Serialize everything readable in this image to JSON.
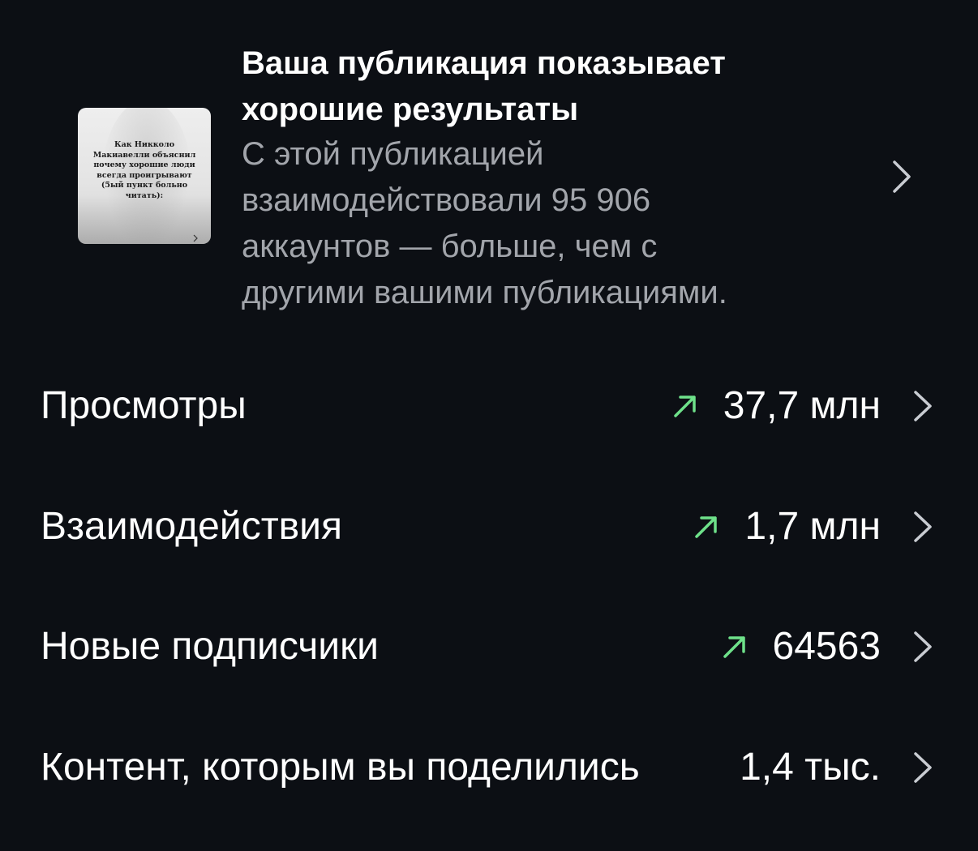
{
  "highlight": {
    "title": "Ваша публикация показывает\nхорошие результаты",
    "description": "С этой публикацией\nвзаимодействовали 95 906\nаккаунтов — больше, чем с\nдругими вашими публикациями.",
    "thumbnail_text": "Как Никколо\nМакиавелли объяснил\nпочему хорошие люди\nвсегда проигрывают\n(5ый пункт больно\nчитать):"
  },
  "metrics": [
    {
      "label": "Просмотры",
      "value": "37,7 млн",
      "trend": "up"
    },
    {
      "label": "Взаимодействия",
      "value": "1,7 млн",
      "trend": "up"
    },
    {
      "label": "Новые подписчики",
      "value": "64563",
      "trend": "up"
    },
    {
      "label": "Контент, которым вы поделились",
      "value": "1,4 тыс.",
      "trend": "none"
    }
  ],
  "colors": {
    "background": "#0c0f14",
    "primary_text": "#ffffff",
    "secondary_text": "#a2a5ab",
    "trend_up": "#6ee18a",
    "chevron": "#c9ccd2"
  },
  "icons": {
    "trend": "arrow-up-right-icon",
    "chevron": "chevron-right-icon"
  }
}
